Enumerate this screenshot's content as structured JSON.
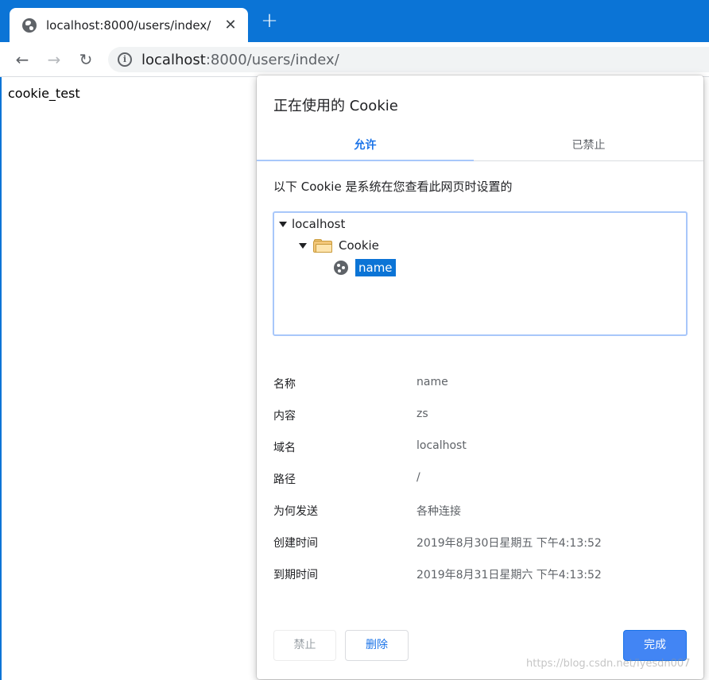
{
  "browser": {
    "tab_title": "localhost:8000/users/index/",
    "url_host": "localhost",
    "url_rest": ":8000/users/index/",
    "accent_color": "#0b74d6"
  },
  "page": {
    "text": "cookie_test"
  },
  "dialog": {
    "title": "正在使用的 Cookie",
    "tabs": [
      "允许",
      "已禁止"
    ],
    "description": "以下 Cookie 是系统在您查看此网页时设置的",
    "tree": {
      "host": "localhost",
      "folder": "Cookie",
      "cookie": "name"
    },
    "properties": [
      {
        "label": "名称",
        "value": "name"
      },
      {
        "label": "内容",
        "value": "zs"
      },
      {
        "label": "域名",
        "value": "localhost"
      },
      {
        "label": "路径",
        "value": "/"
      },
      {
        "label": "为何发送",
        "value": "各种连接"
      },
      {
        "label": "创建时间",
        "value": "2019年8月30日星期五 下午4:13:52"
      },
      {
        "label": "到期时间",
        "value": "2019年8月31日星期六 下午4:13:52"
      }
    ],
    "buttons": {
      "block": "禁止",
      "delete": "删除",
      "done": "完成"
    }
  },
  "watermark": "https://blog.csdn.net/lyesdn007"
}
